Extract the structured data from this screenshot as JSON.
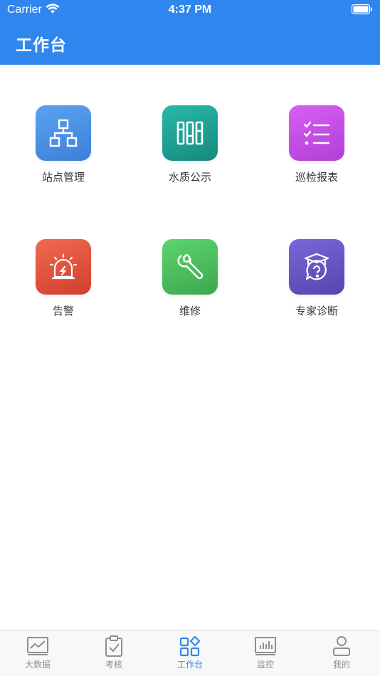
{
  "status_bar": {
    "carrier": "Carrier",
    "time": "4:37 PM"
  },
  "header": {
    "title": "工作台",
    "bg_color": "#2f86ee"
  },
  "tiles": [
    {
      "label": "站点管理",
      "icon": "sitemap-icon",
      "color": "#4a8fe6"
    },
    {
      "label": "水质公示",
      "icon": "columns-icon",
      "color": "#1ea79a"
    },
    {
      "label": "巡检报表",
      "icon": "checklist-icon",
      "color": "#c850e8"
    },
    {
      "label": "告警",
      "icon": "alarm-light-icon",
      "color": "#e0533f"
    },
    {
      "label": "维修",
      "icon": "wrench-icon",
      "color": "#4cc360"
    },
    {
      "label": "专家诊断",
      "icon": "graduation-help-icon",
      "color": "#6a57c8"
    }
  ],
  "tabbar": {
    "items": [
      {
        "label": "大数据",
        "icon": "chart-icon",
        "active": false
      },
      {
        "label": "考核",
        "icon": "clipboard-check-icon",
        "active": false
      },
      {
        "label": "工作台",
        "icon": "grid-icon",
        "active": true
      },
      {
        "label": "监控",
        "icon": "monitor-icon",
        "active": false
      },
      {
        "label": "我的",
        "icon": "person-icon",
        "active": false
      }
    ],
    "active_color": "#2f86ee",
    "inactive_color": "#8e8e93"
  }
}
